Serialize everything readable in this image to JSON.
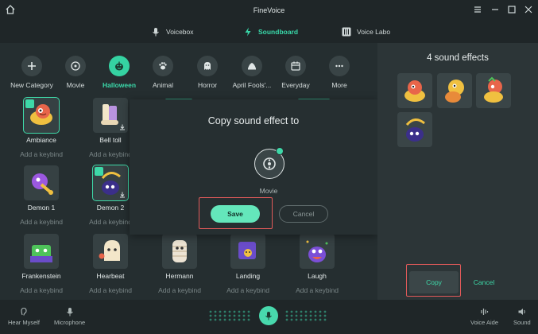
{
  "window": {
    "title": "FineVoice",
    "home_icon": "home-icon",
    "controls": [
      "menu-icon",
      "minimize-icon",
      "maximize-icon",
      "close-icon"
    ]
  },
  "tabs": [
    {
      "label": "Voicebox",
      "icon": "microphone-icon",
      "active": false
    },
    {
      "label": "Soundboard",
      "icon": "bolt-icon",
      "active": true
    },
    {
      "label": "Voice Labo",
      "icon": "sliders-icon",
      "active": false
    }
  ],
  "categories": [
    {
      "label": "New Category",
      "icon": "plus-icon"
    },
    {
      "label": "Movie",
      "icon": "film-reel-icon"
    },
    {
      "label": "Halloween",
      "icon": "pumpkin-icon",
      "active": true
    },
    {
      "label": "Animal",
      "icon": "paw-icon"
    },
    {
      "label": "Horror",
      "icon": "ghost-icon"
    },
    {
      "label": "April Fools'...",
      "icon": "jester-hat-icon"
    },
    {
      "label": "Everyday",
      "icon": "calendar-icon"
    },
    {
      "label": "More",
      "icon": "more-icon"
    }
  ],
  "effects": [
    {
      "name": "Ambiance",
      "keybind": "Add a keybind",
      "selected": true
    },
    {
      "name": "Bell toll",
      "keybind": "Add a keybind",
      "selected": false
    },
    {
      "name": "Demon 1",
      "keybind": "Add a keybind",
      "selected": false
    },
    {
      "name": "Demon 2",
      "keybind": "Add a keybind",
      "selected": true
    },
    {
      "name": "Frankenstein",
      "keybind": "Add a keybind",
      "selected": false
    },
    {
      "name": "Hearbeat",
      "keybind": "Add a keybind",
      "selected": false
    },
    {
      "name": "Hermann",
      "keybind": "Add a keybind",
      "selected": false
    },
    {
      "name": "Landing",
      "keybind": "Add a keybind",
      "selected": false
    },
    {
      "name": "Laugh",
      "keybind": "Add a keybind",
      "selected": false
    }
  ],
  "dialog": {
    "title": "Copy sound effect to",
    "target_name": "Movie",
    "save_label": "Save",
    "cancel_label": "Cancel"
  },
  "right_panel": {
    "title": "4 sound effects",
    "copy_label": "Copy",
    "cancel_label": "Cancel"
  },
  "bottom_bar": {
    "hear_myself": "Hear Myself",
    "microphone": "Microphone",
    "voice_aide": "Voice Aide",
    "sound": "Sound"
  },
  "colors": {
    "accent": "#3ed8a8",
    "highlight_box": "#e25a5a",
    "background": "#252e30"
  }
}
